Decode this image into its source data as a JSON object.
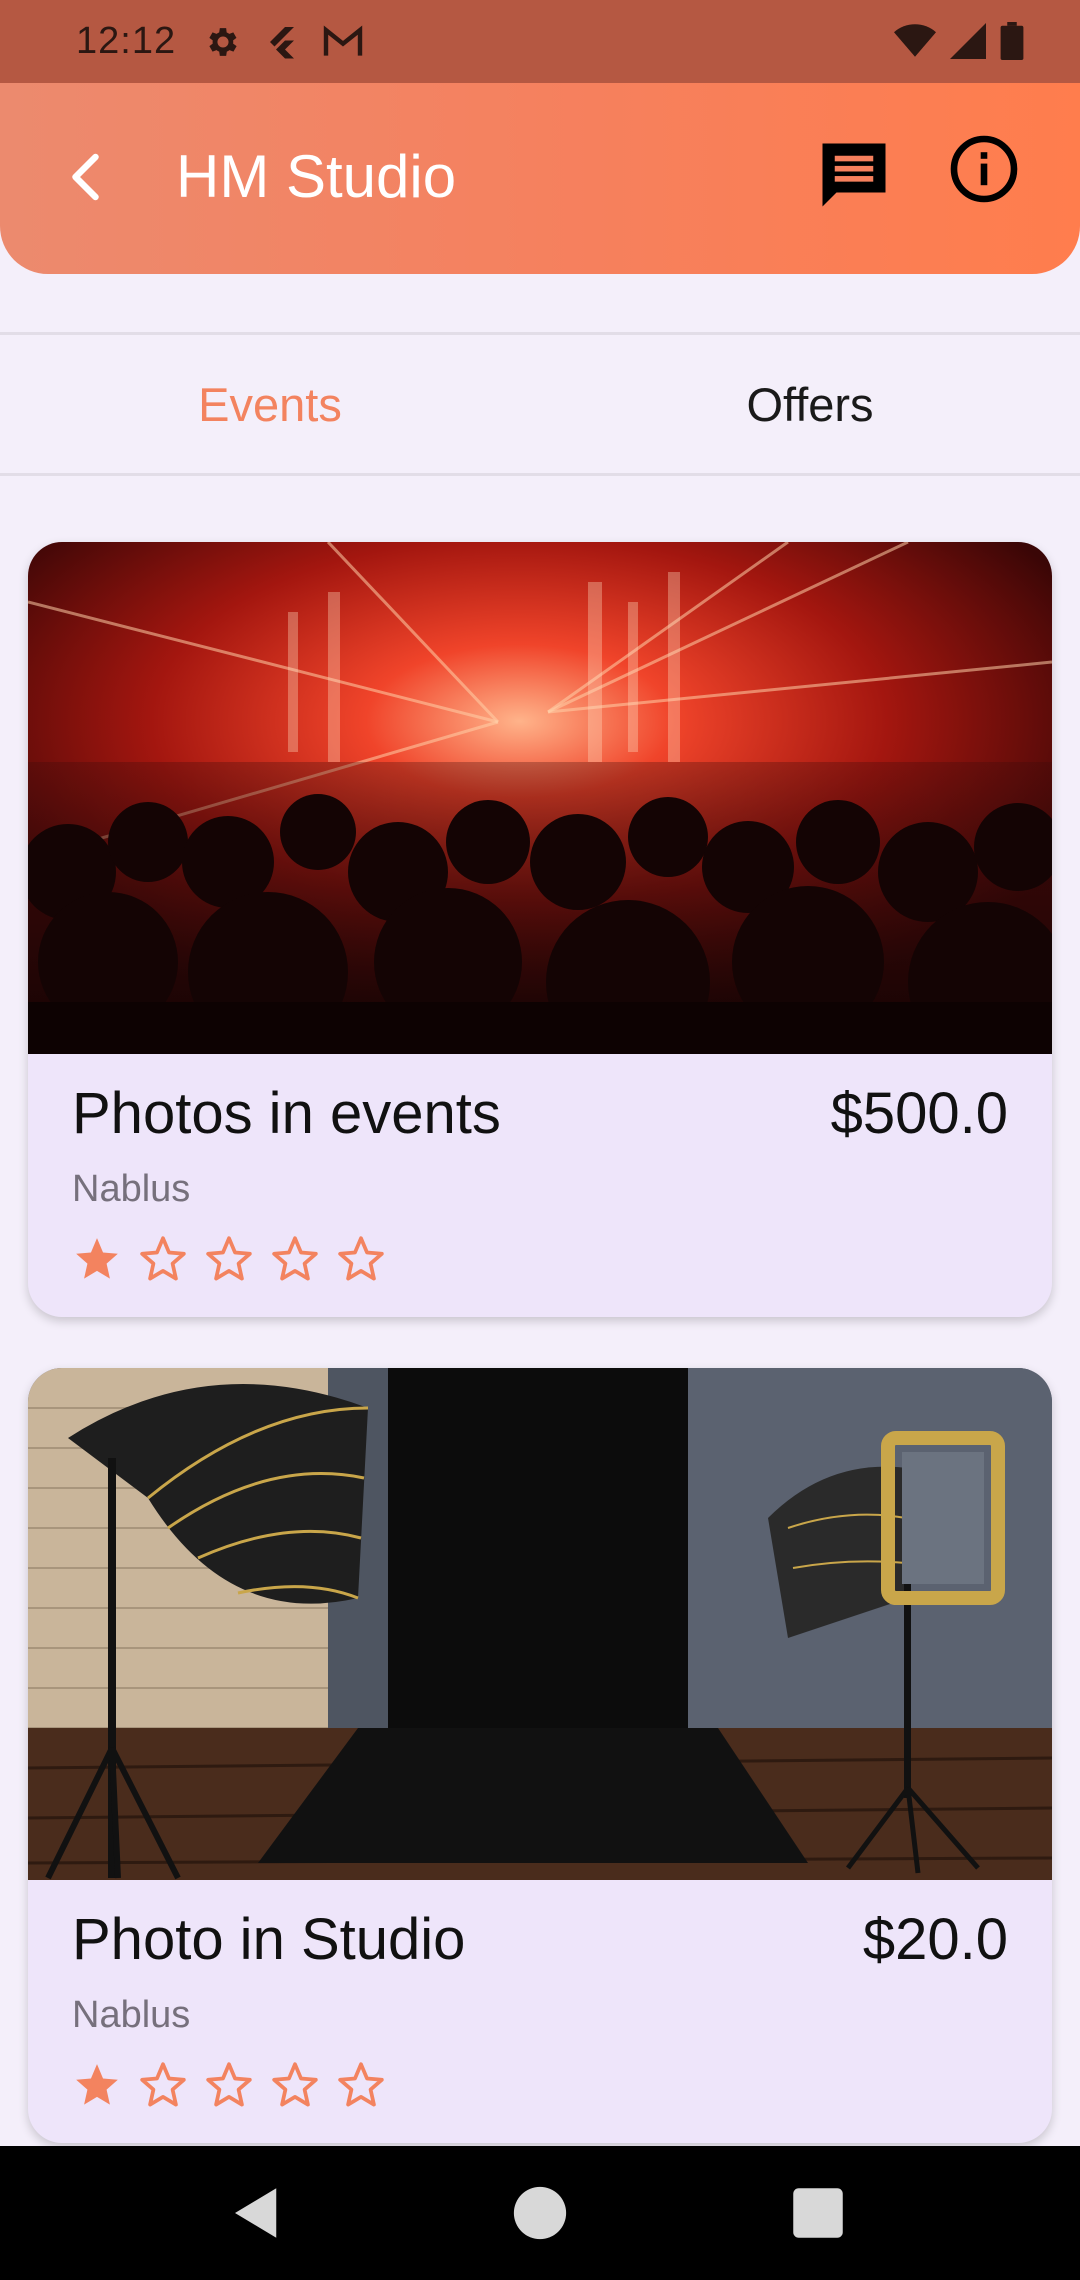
{
  "status_bar": {
    "time": "12:12",
    "icons_left": [
      "gear-icon",
      "flutter-icon",
      "gmail-icon"
    ],
    "icons_right": [
      "wifi-icon",
      "signal-icon",
      "battery-icon"
    ]
  },
  "app_bar": {
    "title": "HM Studio",
    "gradient_colors": [
      "#ec8a6e",
      "#ff7d4d"
    ]
  },
  "tabs": [
    {
      "label": "Events",
      "active": true
    },
    {
      "label": "Offers",
      "active": false
    }
  ],
  "accent_color": "#f3835f",
  "cards": [
    {
      "title": "Photos in events",
      "price": "$500.0",
      "location": "Nablus",
      "rating": 1,
      "max_rating": 5,
      "image": "concert-crowd-image"
    },
    {
      "title": "Photo in Studio",
      "price": "$20.0",
      "location": "Nablus",
      "rating": 1,
      "max_rating": 5,
      "image": "photo-studio-image"
    }
  ],
  "nav_bar": {
    "icons": [
      "back-triangle-icon",
      "home-circle-icon",
      "recents-square-icon"
    ]
  }
}
